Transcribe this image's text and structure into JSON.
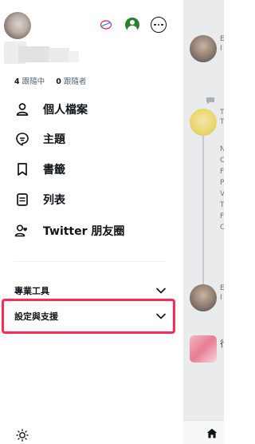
{
  "header": {
    "avatar": "profile-avatar",
    "mini_logo_icon": "twitter-circle-logo-icon",
    "account_icon": "green-account-icon",
    "more_icon": "more-circle-icon"
  },
  "profile": {
    "following_count": "4",
    "following_label": "跟隨中",
    "followers_count": "0",
    "followers_label": "跟隨者"
  },
  "menu": [
    {
      "label": "個人檔案",
      "icon": "person-icon"
    },
    {
      "label": "主題",
      "icon": "topic-bubble-icon"
    },
    {
      "label": "書籤",
      "icon": "bookmark-icon"
    },
    {
      "label": "列表",
      "icon": "list-icon"
    },
    {
      "label": "Twitter 朋友圈",
      "icon": "circle-people-icon"
    }
  ],
  "sections": [
    {
      "label": "專業工具",
      "icon": "chevron-down-icon"
    },
    {
      "label": "設定與支援",
      "icon": "chevron-down-icon"
    }
  ],
  "footer": {
    "icon": "brightness-icon"
  },
  "timeline": {
    "letters": [
      "E",
      "I",
      "T",
      "T",
      "N",
      "C",
      "F",
      "P",
      "V",
      "T",
      "F",
      "C",
      "E",
      "I",
      "行"
    ],
    "home_icon": "home-icon"
  },
  "colors": {
    "highlight": "#ff2d55",
    "accent_green": "#2e7d32",
    "text": "#0f1419",
    "muted": "#536471"
  }
}
